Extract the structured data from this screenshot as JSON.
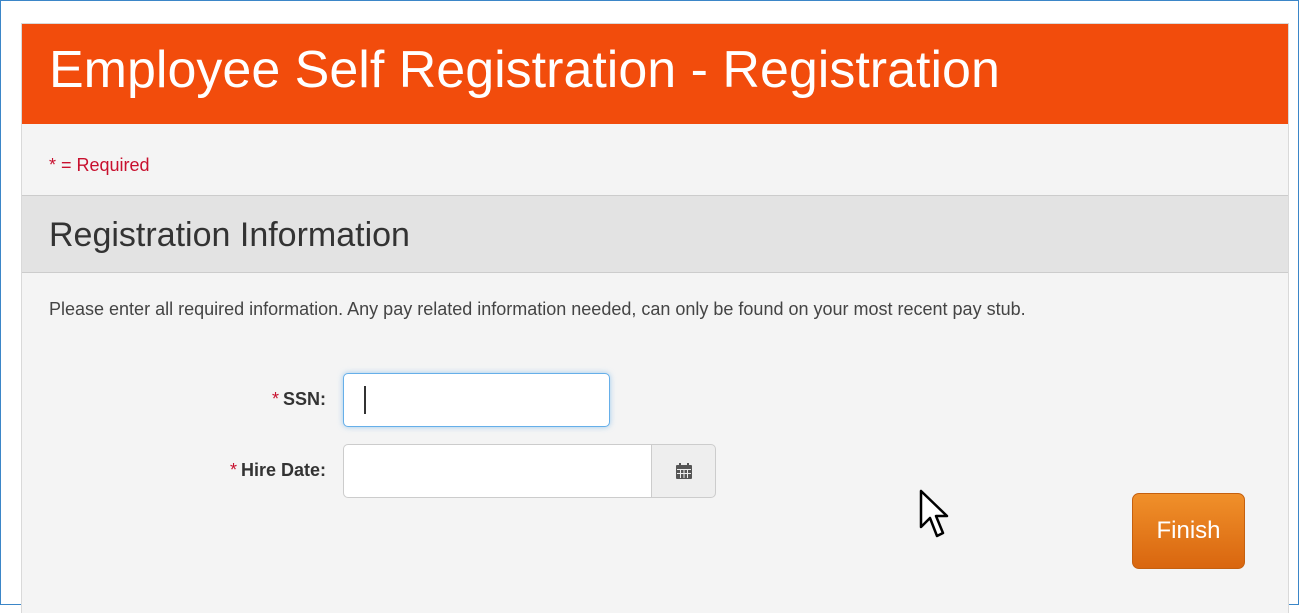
{
  "header": {
    "title": "Employee Self Registration - Registration"
  },
  "required_note": "* = Required",
  "section": {
    "title": "Registration Information"
  },
  "instructions": "Please enter all required information. Any pay related information needed, can only be found on your most recent pay stub.",
  "form": {
    "ssn": {
      "star": "*",
      "label": "SSN:",
      "value": ""
    },
    "hire_date": {
      "star": "*",
      "label": "Hire Date:",
      "value": ""
    }
  },
  "actions": {
    "finish_label": "Finish"
  },
  "icons": {
    "calendar": "calendar-icon",
    "cursor": "mouse-pointer-icon"
  },
  "colors": {
    "header_bg": "#f24c0c",
    "required_red": "#c8102e",
    "finish_orange": "#e07418"
  }
}
